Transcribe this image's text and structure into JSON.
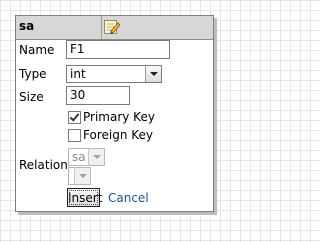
{
  "table": {
    "name": "sa",
    "edit_icon": "edit-pencil-icon"
  },
  "form": {
    "name_label": "Name",
    "name_value": "F1",
    "type_label": "Type",
    "type_value": "int",
    "size_label": "Size",
    "size_value": "30",
    "primary_key_label": "Primary Key",
    "primary_key_checked": true,
    "foreign_key_label": "Foreign Key",
    "foreign_key_checked": false,
    "relation_label": "Relation",
    "relation_table_value": "sa",
    "relation_field_value": ""
  },
  "actions": {
    "insert_label": "Insert",
    "cancel_label": "Cancel"
  },
  "colors": {
    "titlebar_bg": "#d7d7d7",
    "link": "#1f4f9b"
  }
}
